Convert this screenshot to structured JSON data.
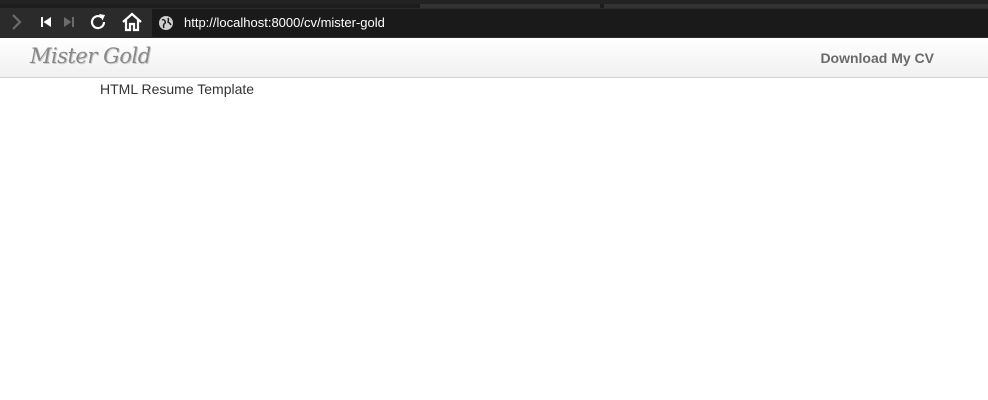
{
  "browser": {
    "url": "http://localhost:8000/cv/mister-gold"
  },
  "header": {
    "logo_text": "Mister Gold",
    "download_label": "Download My CV"
  },
  "main": {
    "subtitle": "HTML Resume Template"
  },
  "icons": {
    "forward": "chevron-right-icon",
    "rewind": "skip-back-icon",
    "fast_forward": "skip-forward-icon",
    "reload": "reload-icon",
    "home": "home-icon",
    "site_info": "globe-icon"
  },
  "colors": {
    "toolbar_bg": "#2b2b2b",
    "address_bg": "#1a1a1a",
    "header_text": "#6a6a6a",
    "logo_color": "#888888",
    "body_text": "#333333"
  }
}
